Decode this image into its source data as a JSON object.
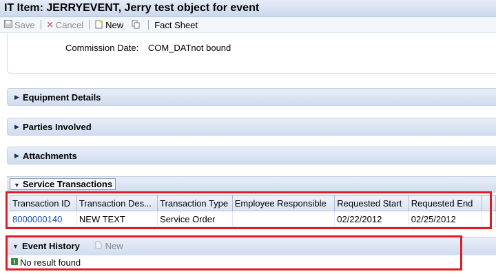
{
  "window": {
    "title": "IT Item: JERRYEVENT, Jerry test object for event"
  },
  "toolbar": {
    "save_label": "Save",
    "cancel_label": "Cancel",
    "new_label": "New",
    "fact_sheet_label": "Fact Sheet"
  },
  "form": {
    "commission_date_label": "Commission Date:",
    "commission_date_value": "COM_DATnot bound"
  },
  "sections": {
    "equipment_details": "Equipment Details",
    "parties_involved": "Parties Involved",
    "attachments": "Attachments",
    "service_transactions": "Service Transactions"
  },
  "service_table": {
    "columns": [
      "Transaction ID",
      "Transaction Des...",
      "Transaction Type",
      "Employee Responsible",
      "Requested Start",
      "Requested End"
    ],
    "rows": [
      {
        "id": "8000000140",
        "description": "NEW TEXT",
        "type": "Service Order",
        "employee": "",
        "start": "02/22/2012",
        "end": "02/25/2012"
      }
    ]
  },
  "event_history": {
    "title": "Event History",
    "new_label": "New",
    "message": "No result found"
  },
  "colors": {
    "highlight": "#e01b23",
    "link": "#1a4fb3",
    "header_bg": "#d0dcef"
  }
}
